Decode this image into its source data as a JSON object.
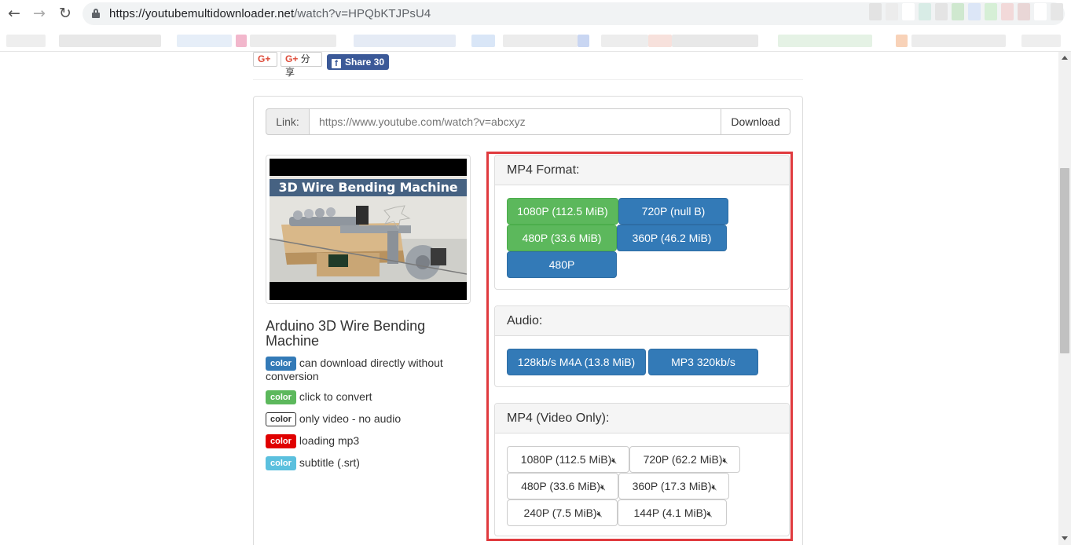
{
  "browser": {
    "url_host": "https://youtubemultidownloader.net",
    "url_path": "/watch?v=HPQbKTJPsU4",
    "back_icon": "←",
    "forward_icon": "→",
    "reload_icon": "↻"
  },
  "share": {
    "gplus_label": "G+",
    "gplus_share_label": "分享",
    "facebook_label": "Share 30",
    "facebook_icon": "f"
  },
  "link_bar": {
    "addon": "Link:",
    "placeholder": "https://www.youtube.com/watch?v=abcxyz",
    "download_label": "Download"
  },
  "video": {
    "thumbnail_title": "3D Wire Bending Machine",
    "title": "Arduino 3D Wire Bending Machine"
  },
  "legend": [
    {
      "badge": "color",
      "text": "can download directly without conversion",
      "style": "primary"
    },
    {
      "badge": "color",
      "text": "click to convert",
      "style": "success"
    },
    {
      "badge": "color",
      "text": "only video - no audio",
      "style": "default"
    },
    {
      "badge": "color",
      "text": "loading mp3",
      "style": "danger"
    },
    {
      "badge": "color",
      "text": "subtitle (.srt)",
      "style": "info"
    }
  ],
  "formats": {
    "mp4": {
      "heading": "MP4 Format:",
      "buttons": [
        {
          "label": "1080P (112.5 MiB)",
          "style": "green"
        },
        {
          "label": "720P (null B)",
          "style": "blue"
        },
        {
          "label": "480P (33.6 MiB)",
          "style": "green"
        },
        {
          "label": "360P (46.2 MiB)",
          "style": "blue"
        },
        {
          "label": "480P",
          "style": "blue"
        }
      ]
    },
    "audio": {
      "heading": "Audio:",
      "buttons": [
        {
          "label": "128kb/s M4A (13.8 MiB)",
          "style": "blue"
        },
        {
          "label": "MP3 320kb/s",
          "style": "blue"
        }
      ]
    },
    "video_only": {
      "heading": "MP4 (Video Only):",
      "mute_icon": "🔇︎",
      "buttons": [
        {
          "label": "1080P (112.5 MiB)"
        },
        {
          "label": "720P (62.2 MiB)"
        },
        {
          "label": "480P (33.6 MiB)"
        },
        {
          "label": "360P (17.3 MiB)"
        },
        {
          "label": "240P (7.5 MiB)"
        },
        {
          "label": "144P (4.1 MiB)"
        }
      ]
    }
  },
  "colors": {
    "accent_blue": "#337ab7",
    "accent_green": "#5cb85c",
    "highlight_red": "#e03a3e",
    "facebook_blue": "#3b5998"
  }
}
